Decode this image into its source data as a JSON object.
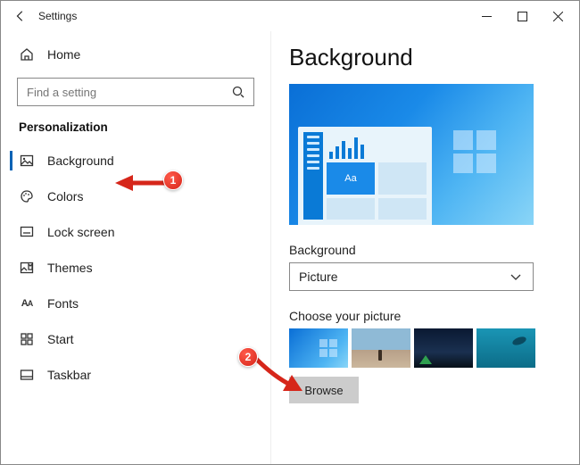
{
  "window": {
    "title": "Settings"
  },
  "sidebar": {
    "home_label": "Home",
    "search_placeholder": "Find a setting",
    "section_label": "Personalization",
    "items": [
      {
        "label": "Background",
        "active": true
      },
      {
        "label": "Colors"
      },
      {
        "label": "Lock screen"
      },
      {
        "label": "Themes"
      },
      {
        "label": "Fonts"
      },
      {
        "label": "Start"
      },
      {
        "label": "Taskbar"
      }
    ]
  },
  "page": {
    "heading": "Background",
    "preview_sample_text": "Aa",
    "dropdown_label": "Background",
    "dropdown_value": "Picture",
    "choose_label": "Choose your picture",
    "browse_label": "Browse"
  },
  "callouts": {
    "one": "1",
    "two": "2"
  }
}
